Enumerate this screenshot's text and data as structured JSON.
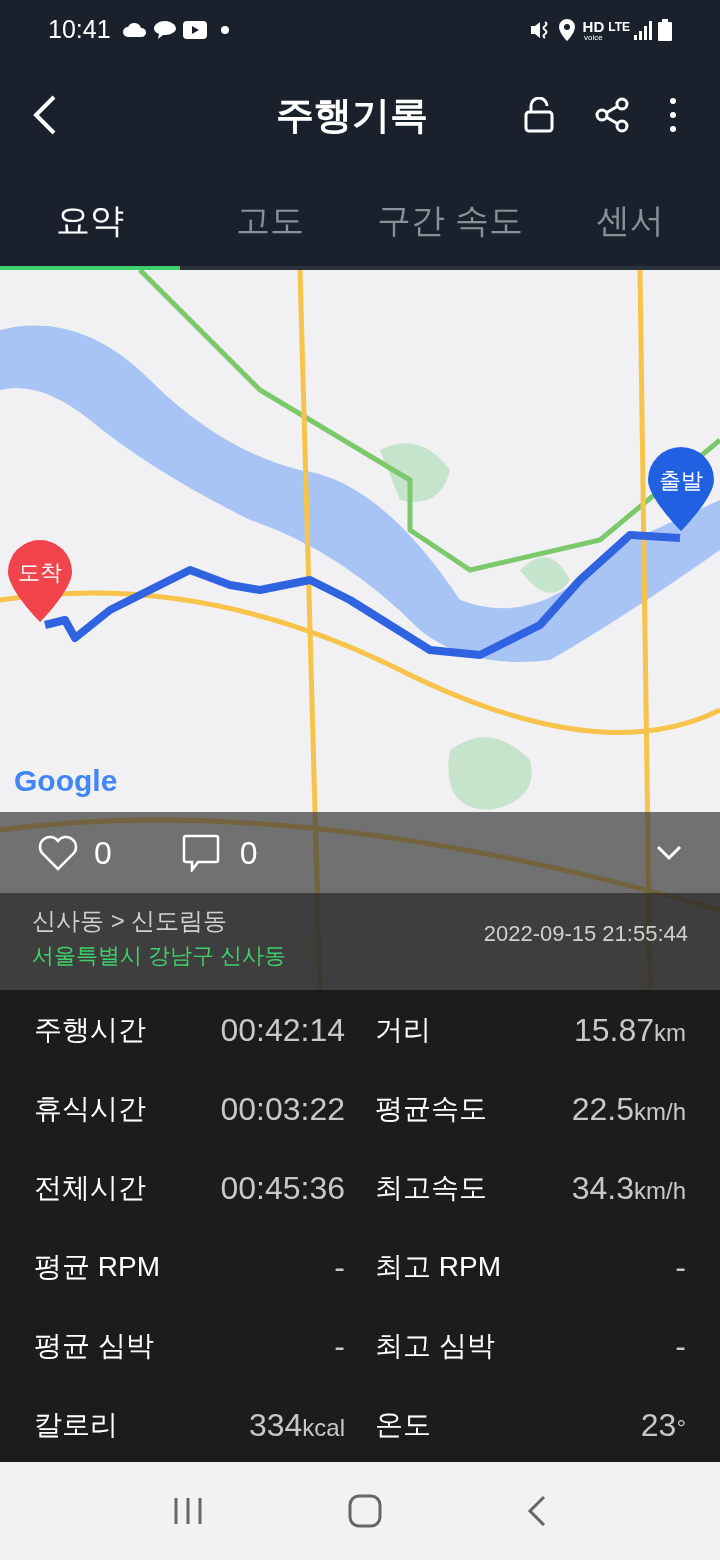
{
  "status_bar": {
    "time": "10:41",
    "hd": "HD",
    "voice": "voice",
    "network": "LTE"
  },
  "header": {
    "title": "주행기록"
  },
  "tabs": [
    {
      "label": "요약",
      "selected": true
    },
    {
      "label": "고도",
      "selected": false
    },
    {
      "label": "구간 속도",
      "selected": false
    },
    {
      "label": "센서",
      "selected": false
    }
  ],
  "map": {
    "start_label": "출발",
    "end_label": "도착",
    "attribution": "Google"
  },
  "social": {
    "likes": "0",
    "comments": "0"
  },
  "ride": {
    "route": "신사동 > 신도림동",
    "address": "서울특별시 강남구 신사동",
    "date": "2022-09-15 21:55:44"
  },
  "stats": [
    {
      "label": "주행시간",
      "value": "00:42:14"
    },
    {
      "label": "거리",
      "value": "15.87",
      "unit": "km"
    },
    {
      "label": "휴식시간",
      "value": "00:03:22"
    },
    {
      "label": "평균속도",
      "value": "22.5",
      "unit": "km/h"
    },
    {
      "label": "전체시간",
      "value": "00:45:36"
    },
    {
      "label": "최고속도",
      "value": "34.3",
      "unit": "km/h"
    },
    {
      "label": "평균 RPM",
      "value": "-"
    },
    {
      "label": "최고 RPM",
      "value": "-"
    },
    {
      "label": "평균 심박",
      "value": "-"
    },
    {
      "label": "최고 심박",
      "value": "-"
    },
    {
      "label": "칼로리",
      "value": "334",
      "unit": "kcal"
    },
    {
      "label": "온도",
      "value": "23",
      "unit": "°"
    }
  ]
}
